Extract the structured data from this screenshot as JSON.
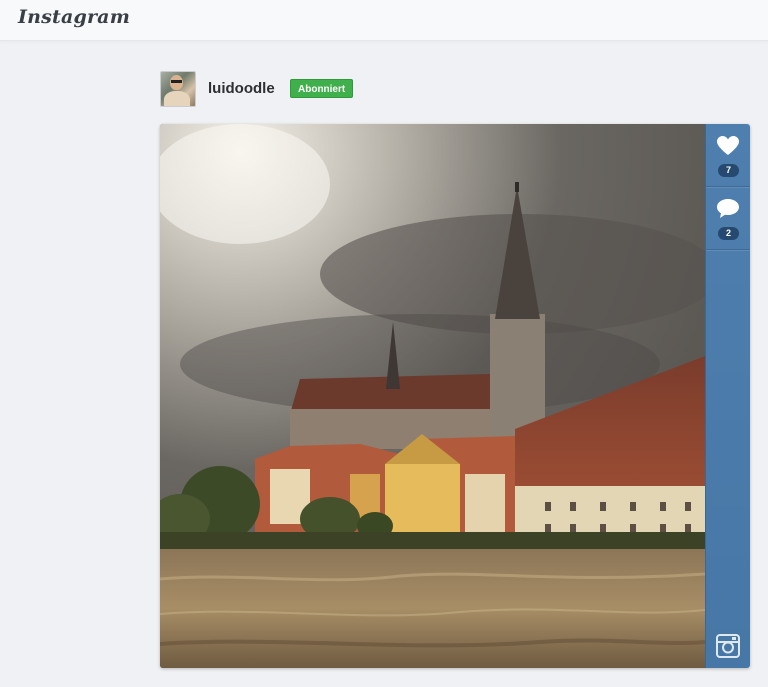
{
  "header": {
    "logo_text": "Instagram"
  },
  "post": {
    "username": "luidoodle",
    "follow_label": "Abonniert",
    "likes_count": "7",
    "comments_count": "2",
    "image_subject": "flooded-river-cathedral-photo"
  },
  "icons": {
    "like": "heart-icon",
    "comment": "speech-bubble-icon",
    "brand": "instagram-camera-icon"
  },
  "colors": {
    "follow_green": "#3fb04b",
    "action_rail_blue": "#4a7aa9",
    "count_badge": "#26496f"
  }
}
